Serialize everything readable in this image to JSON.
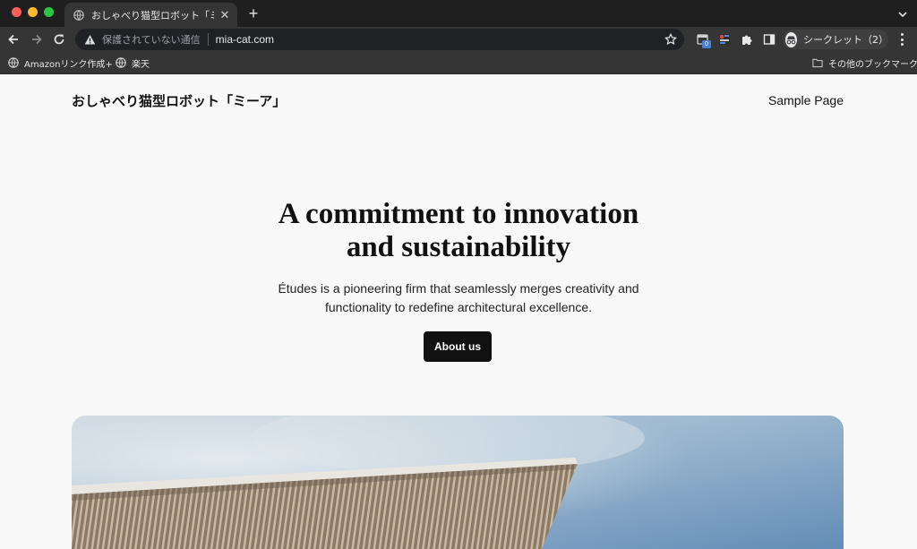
{
  "browser": {
    "tab_title": "おしゃべり猫型ロボット「ミーア」",
    "tab_close": "✕",
    "new_tab": "+",
    "omnibox": {
      "security_label": "保護されていない通信",
      "url": "mia-cat.com"
    },
    "extension_badge": "0",
    "profile_label": "シークレット（2）",
    "bookmarks": [
      {
        "label": "Amazonリンク作成+"
      },
      {
        "label": "楽天"
      }
    ],
    "other_bookmarks": "その他のブックマーク"
  },
  "site": {
    "title": "おしゃべり猫型ロボット「ミーア」",
    "nav_link": "Sample Page"
  },
  "hero": {
    "heading_line1": "A commitment to innovation",
    "heading_line2": "and sustainability",
    "sub_line1": "Études is a pioneering firm that seamlessly merges creativity and",
    "sub_line2": "functionality to redefine architectural excellence.",
    "cta_label": "About us"
  }
}
